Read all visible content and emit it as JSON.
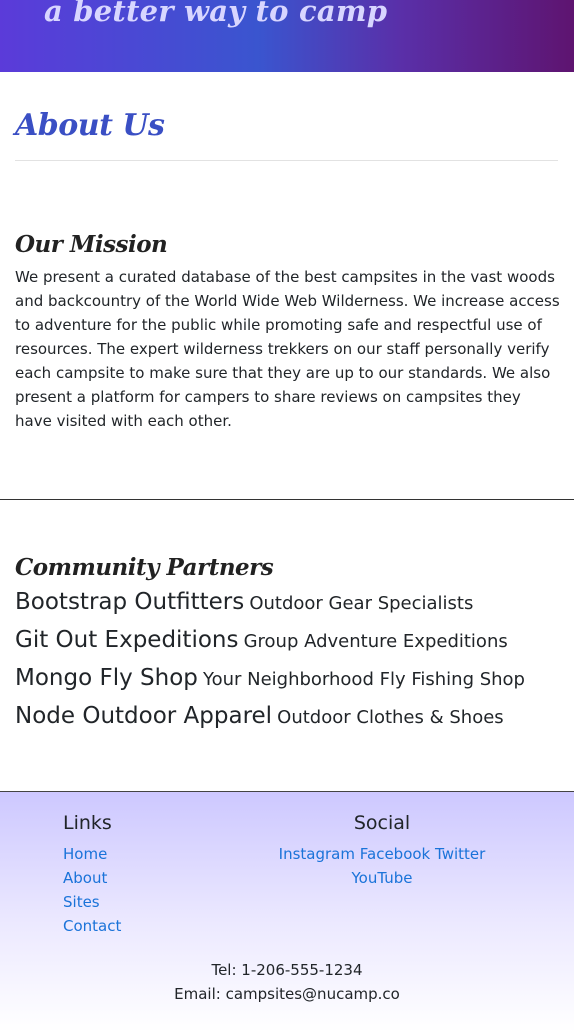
{
  "header": {
    "tagline": "a better way to camp"
  },
  "page": {
    "title": "About Us"
  },
  "mission": {
    "heading": "Our Mission",
    "text": "We present a curated database of the best campsites in the vast woods and backcountry of the World Wide Web Wilderness. We increase access to adventure for the public while promoting safe and respectful use of resources. The expert wilderness trekkers on our staff personally verify each campsite to make sure that they are up to our standards. We also present a platform for campers to share reviews on campsites they have visited with each other."
  },
  "partners": {
    "heading": "Community Partners",
    "items": [
      {
        "name": "Bootstrap Outfitters",
        "desc": "Outdoor Gear Specialists"
      },
      {
        "name": "Git Out Expeditions",
        "desc": "Group Adventure Expeditions"
      },
      {
        "name": "Mongo Fly Shop",
        "desc": "Your Neighborhood Fly Fishing Shop"
      },
      {
        "name": "Node Outdoor Apparel",
        "desc": "Outdoor Clothes & Shoes"
      }
    ]
  },
  "footer": {
    "links_heading": "Links",
    "links": [
      "Home",
      "About",
      "Sites",
      "Contact"
    ],
    "social_heading": "Social",
    "social": [
      "Instagram",
      "Facebook",
      "Twitter",
      "YouTube"
    ],
    "tel": "Tel: 1-206-555-1234",
    "email": "Email: campsites@nucamp.co"
  },
  "colors": {
    "header_gradient_start": "#5b3bd9",
    "header_gradient_end": "#5e1470",
    "title_blue": "#3a4fc4",
    "link_blue": "#1a73d9",
    "footer_bg_top": "#cdc8ff"
  }
}
